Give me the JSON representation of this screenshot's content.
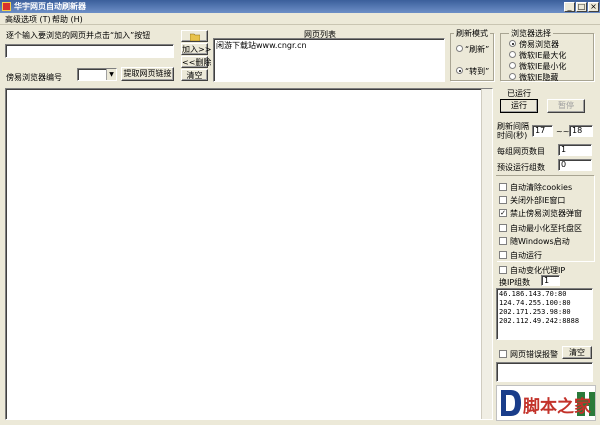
{
  "window": {
    "title": "华宇网页自动刷新器"
  },
  "menu": {
    "items": [
      "高级选项 (T)",
      "帮助 (H)"
    ]
  },
  "url_entry": {
    "instruction": "逐个输入要浏览的网页并点击“加入”按钮",
    "value": ""
  },
  "buttons": {
    "add": "加入>>",
    "delete": "<<删除",
    "clear": "清空",
    "fetch_links": "提取网页链接",
    "run": "运行",
    "pause": "暂停",
    "clear_bottom": "清空"
  },
  "browser_no": {
    "label": "傍易浏览器编号",
    "value": ""
  },
  "page_list": {
    "title": "网页列表",
    "items": [
      "闲游下载站www.cngr.cn"
    ]
  },
  "refresh_mode": {
    "title": "刷新模式",
    "options": [
      "“刷新”",
      "“转到”"
    ],
    "selected": 1
  },
  "browser_select": {
    "title": "浏览器选择",
    "options": [
      "傍易浏览器",
      "微软IE最大化",
      "微软IE最小化",
      "微软IE隐藏"
    ],
    "selected": 0
  },
  "status": {
    "label": "已运行"
  },
  "settings": {
    "interval_label": "刷新间隔\n时间(秒)",
    "interval_min": "17",
    "interval_sep": "~~",
    "interval_max": "18",
    "pages_per_group_label": "每组网页数目",
    "pages_per_group": "1",
    "preset_groups_label": "预设运行组数",
    "preset_groups": "0"
  },
  "options": [
    {
      "label": "自动清除cookies",
      "checked": false
    },
    {
      "label": "关闭外部IE窗口",
      "checked": false
    },
    {
      "label": "禁止傍易浏览器弹窗",
      "checked": true
    },
    {
      "label": "自动最小化至托盘区",
      "checked": false
    },
    {
      "label": "随Windows启动",
      "checked": false
    },
    {
      "label": "自动运行",
      "checked": false
    },
    {
      "label": "自动变化代理IP",
      "checked": false
    }
  ],
  "proxy": {
    "change_label": "换IP组数",
    "change_value": "1",
    "list": [
      "46.186.143.70:80",
      "124.74.255.100:80",
      "202.171.253.98:80",
      "202.112.49.242:8888"
    ]
  },
  "error_alert": {
    "label": "网页错误报警",
    "checked": false
  },
  "logo": {
    "text": "脚本之家"
  }
}
